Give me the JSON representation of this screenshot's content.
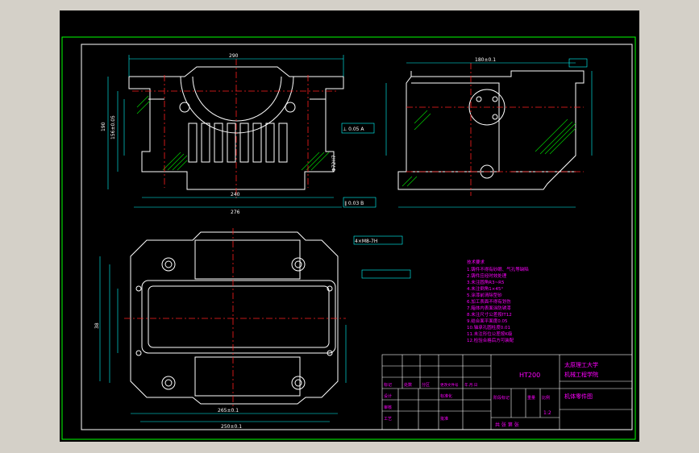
{
  "colors": {
    "background": "#000000",
    "frame": "#00ff00",
    "part_outline": "#ffffff",
    "center_line": "#ff2020",
    "dimension": "#00ffff",
    "hatch": "#00d000",
    "notes": "#ff00ff",
    "title_text": "#ff00ff",
    "title_grid": "#ffffff"
  },
  "title_block": {
    "material": "HT200",
    "school": "太原理工大学",
    "dept": "机械工程学院",
    "drawing_name": "机体零件图",
    "scale": "1:2",
    "sheet": "共 张  第 张",
    "mark_label": "阶段标记",
    "weight_label": "重量",
    "ratio_label": "比例",
    "designer_label": "设计",
    "std_label": "标准化",
    "review_label": "审核",
    "process_label": "工艺",
    "approve_label": "批准",
    "qty_label": "处数",
    "zone_label": "分区",
    "change_label": "更改文件号",
    "sign_label": "签名",
    "date_label": "年.月.日",
    "mark_col": "标记"
  },
  "tech_notes": {
    "heading": "技术要求",
    "lines": [
      "1.铸件不得有砂眼、气孔等缺陷",
      "2.铸件应经时效处理",
      "3.未注圆角R3~R5",
      "4.未注倒角1×45°",
      "5.涂漆前清除型砂",
      "6.加工表面不得有划伤",
      "7.箱体内表面涂防锈漆",
      "8.未注尺寸公差按IT12",
      "9.结合面平面度0.05",
      "10.轴承孔圆柱度0.01",
      "11.未注形位公差按K级",
      "12.检验合格后方可装配"
    ]
  },
  "dimensions": {
    "top_width": "290",
    "side_width": "180±0.1",
    "bottom_width_1": "240",
    "bottom_width_2": "276",
    "plan_width": "265±0.1",
    "plan_width_2": "250±0.1",
    "vertical_1": "190",
    "vertical_2": "156±0.05",
    "vertical_3": "38",
    "hole_spec": "4×M8-7H",
    "bore": "Φ72H7",
    "tol_box_1": "⊥ 0.05 A",
    "tol_box_2": "∥ 0.03 B"
  }
}
